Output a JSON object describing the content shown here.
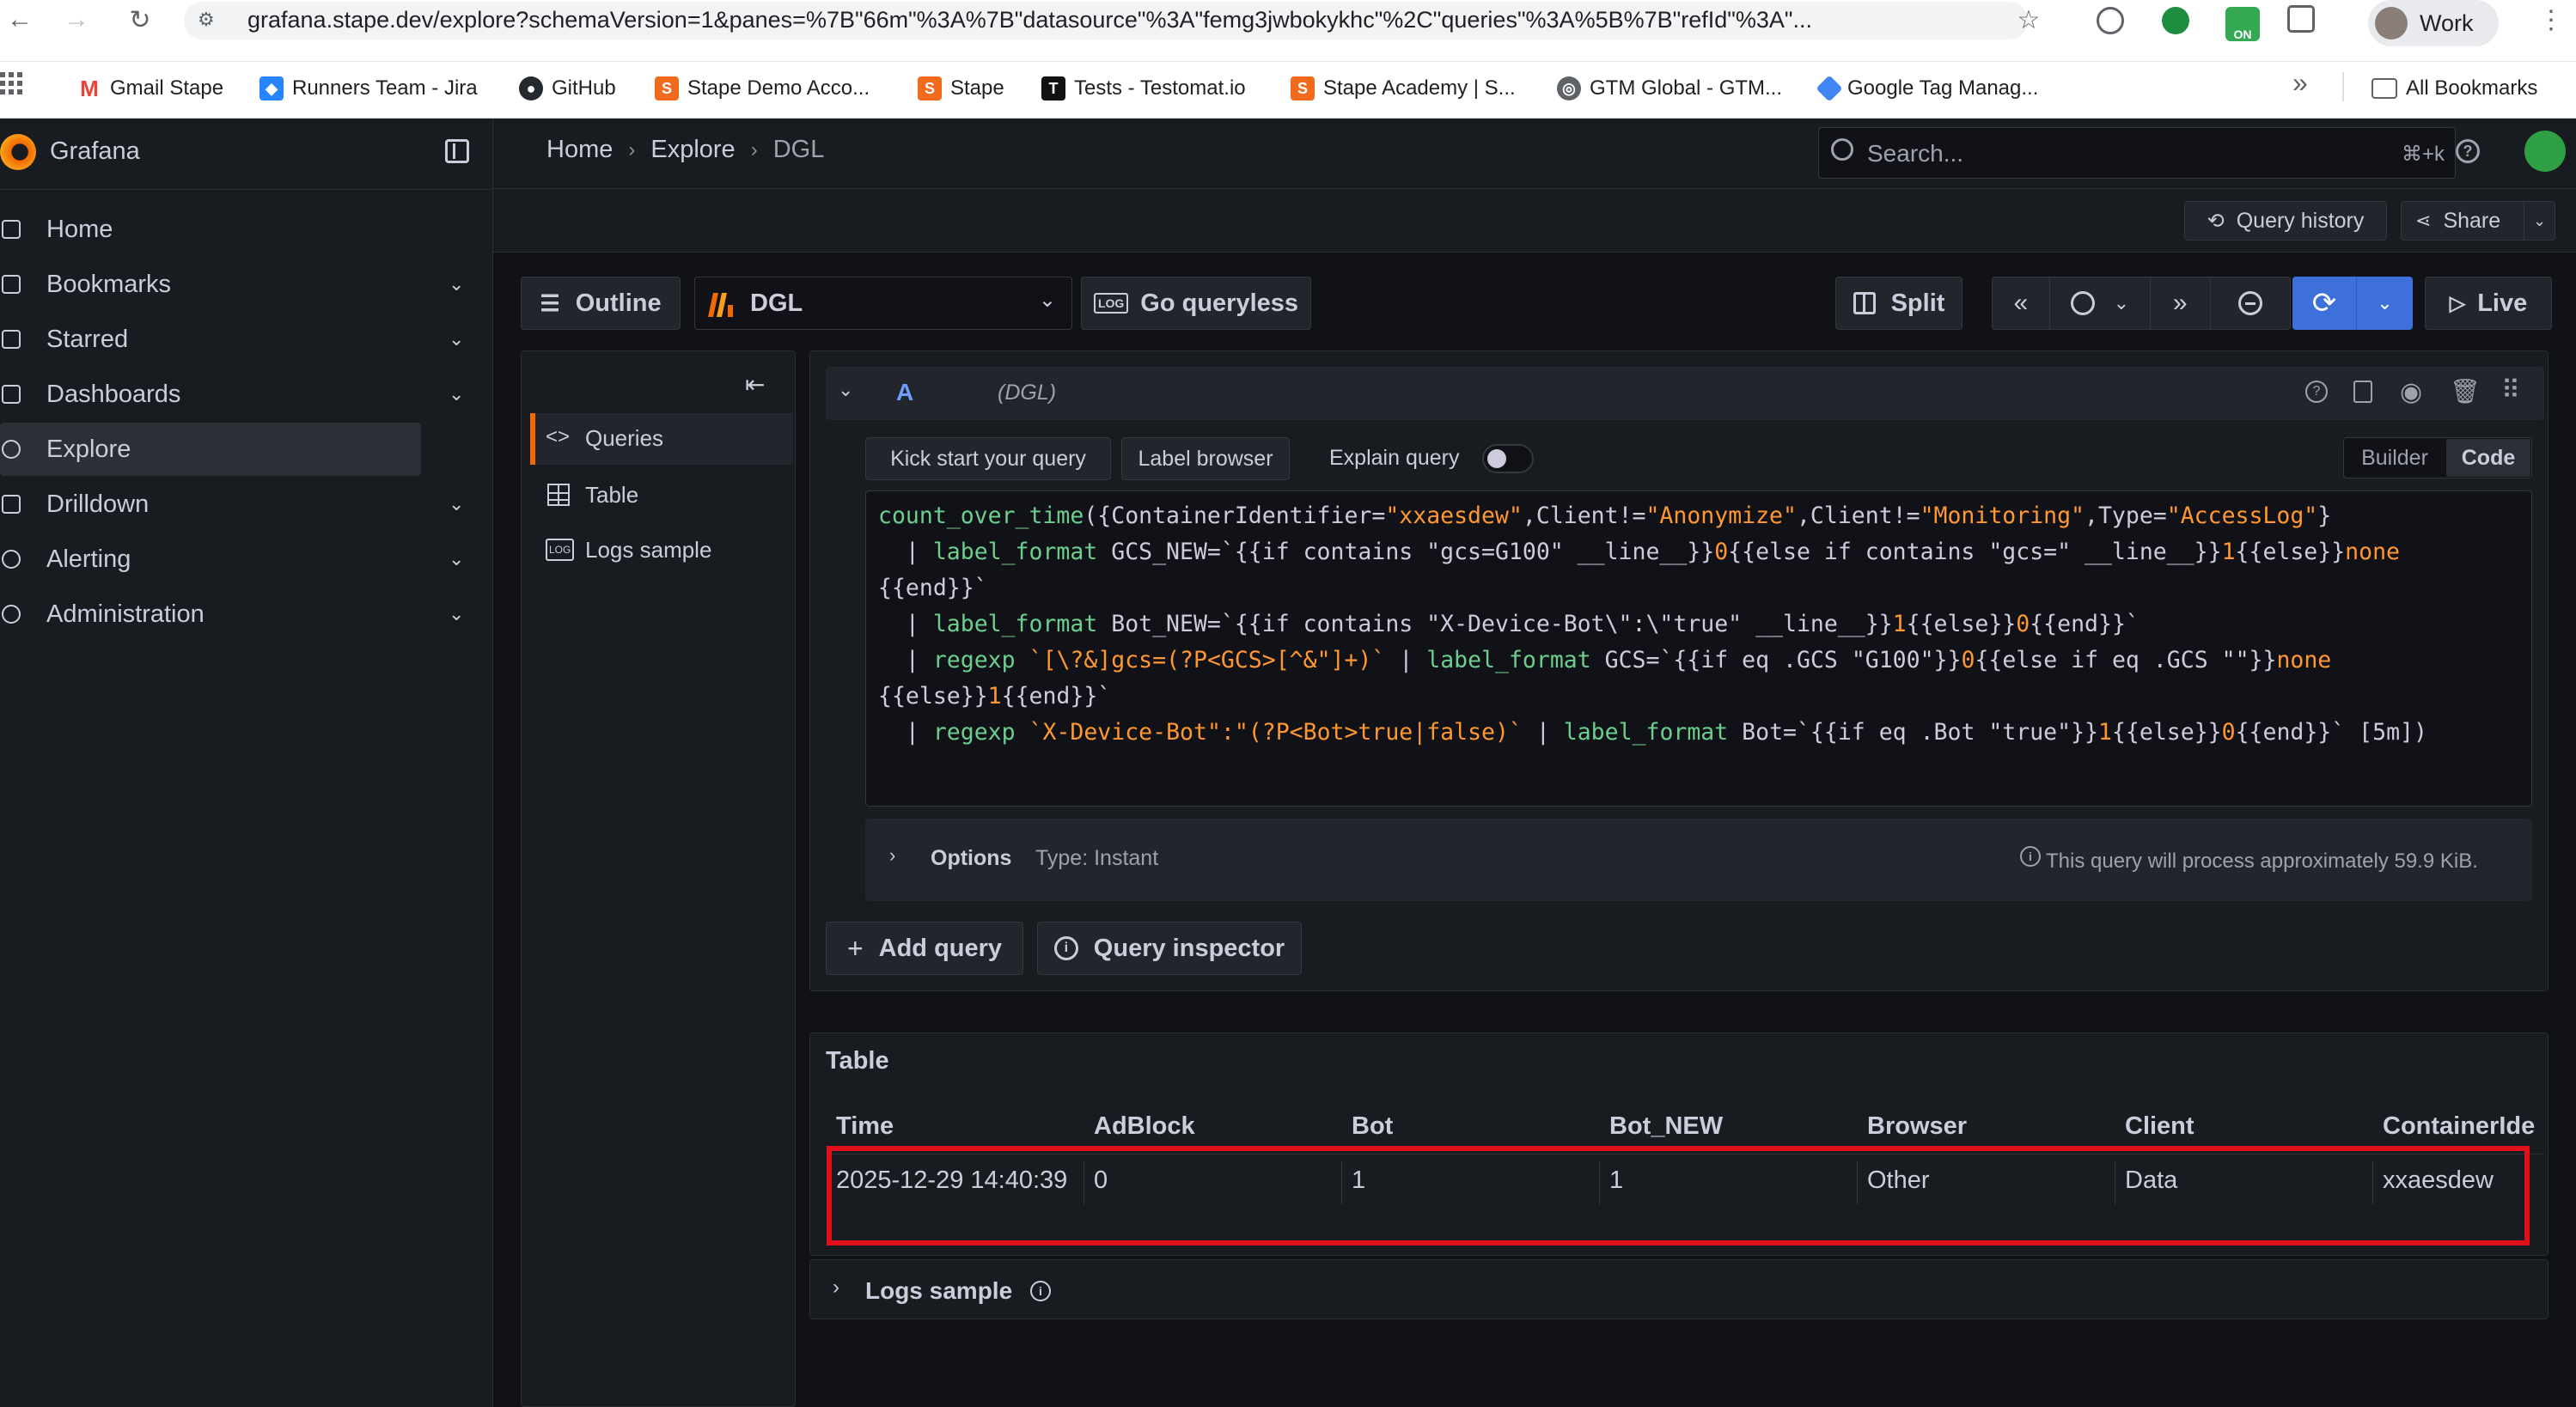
{
  "browser": {
    "url": "grafana.stape.dev/explore?schemaVersion=1&panes=%7B\"66m\"%3A%7B\"datasource\"%3A\"femg3jwbokykhc\"%2C\"queries\"%3A%5B%7B\"refId\"%3A\"...",
    "profile_label": "Work",
    "bookmarks": [
      "Gmail Stape",
      "Runners Team - Jira",
      "GitHub",
      "Stape Demo Acco...",
      "Stape",
      "Tests - Testomat.io",
      "Stape Academy | S...",
      "GTM Global - GTM...",
      "Google Tag Manag..."
    ],
    "more_label": "»",
    "all_bookmarks": "All Bookmarks"
  },
  "app": {
    "brand": "Grafana",
    "breadcrumb": [
      "Home",
      "Explore",
      "DGL"
    ],
    "search_placeholder": "Search...",
    "search_shortcut": "⌘+k"
  },
  "sidebar": {
    "items": [
      {
        "label": "Home",
        "icon": "home-icon",
        "chevron": false,
        "active": false
      },
      {
        "label": "Bookmarks",
        "icon": "bookmark-icon",
        "chevron": true,
        "active": false
      },
      {
        "label": "Starred",
        "icon": "star-icon",
        "chevron": true,
        "active": false
      },
      {
        "label": "Dashboards",
        "icon": "dashboards-icon",
        "chevron": true,
        "active": false
      },
      {
        "label": "Explore",
        "icon": "compass-icon",
        "chevron": false,
        "active": true
      },
      {
        "label": "Drilldown",
        "icon": "drilldown-icon",
        "chevron": true,
        "active": false
      },
      {
        "label": "Alerting",
        "icon": "bell-icon",
        "chevron": true,
        "active": false
      },
      {
        "label": "Administration",
        "icon": "gear-icon",
        "chevron": true,
        "active": false
      }
    ]
  },
  "toolbar": {
    "query_history": "Query history",
    "share": "Share",
    "outline": "Outline",
    "datasource": "DGL",
    "go_queryless": "Go queryless",
    "split": "Split",
    "live": "Live"
  },
  "outline": {
    "items": [
      "Queries",
      "Table",
      "Logs sample"
    ]
  },
  "query": {
    "ref": "A",
    "datasource_tag": "(DGL)",
    "kick_start": "Kick start your query",
    "label_browser": "Label browser",
    "explain_query": "Explain query",
    "mode_builder": "Builder",
    "mode_code": "Code",
    "options_label": "Options",
    "options_type": "Type: Instant",
    "process_note": "This query will process approximately 59.9 KiB.",
    "add_query": "Add query",
    "query_inspector": "Query inspector"
  },
  "table": {
    "title": "Table",
    "columns": [
      "Time",
      "AdBlock",
      "Bot",
      "Bot_NEW",
      "Browser",
      "Client",
      "ContainerIde"
    ],
    "rows": [
      [
        "2025-12-29 14:40:39",
        "0",
        "1",
        "1",
        "Other",
        "Data",
        "xxaesdew"
      ]
    ]
  },
  "logs_sample": {
    "title": "Logs sample"
  },
  "colors": {
    "accent_blue": "#3d71d9",
    "highlight_red": "#e0101a",
    "code_green": "#6ccf8e",
    "code_orange": "#ff9830"
  }
}
